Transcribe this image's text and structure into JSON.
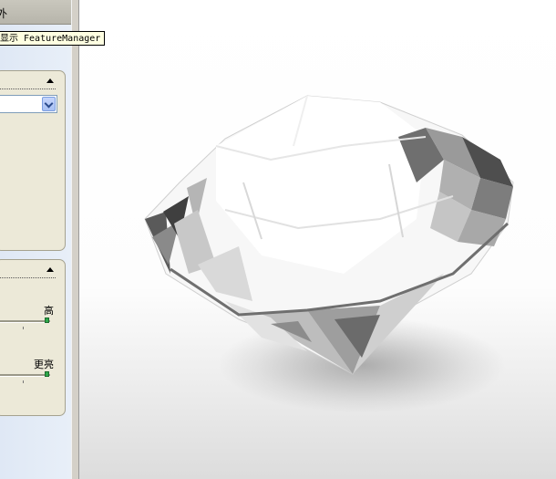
{
  "header": {
    "title": "外"
  },
  "tooltip": {
    "text": "显示 FeatureManager"
  },
  "panel1": {
    "dropdown_value": ""
  },
  "panel2": {
    "slider1_label": "高",
    "slider2_label": "更亮"
  },
  "colors": {
    "accent": "#2ea84a",
    "panel_bg": "#ece9d8",
    "sidebar_bg": "#dfe8f5"
  },
  "icons": [
    "collapse-arrow-icon",
    "chevron-down-icon"
  ]
}
